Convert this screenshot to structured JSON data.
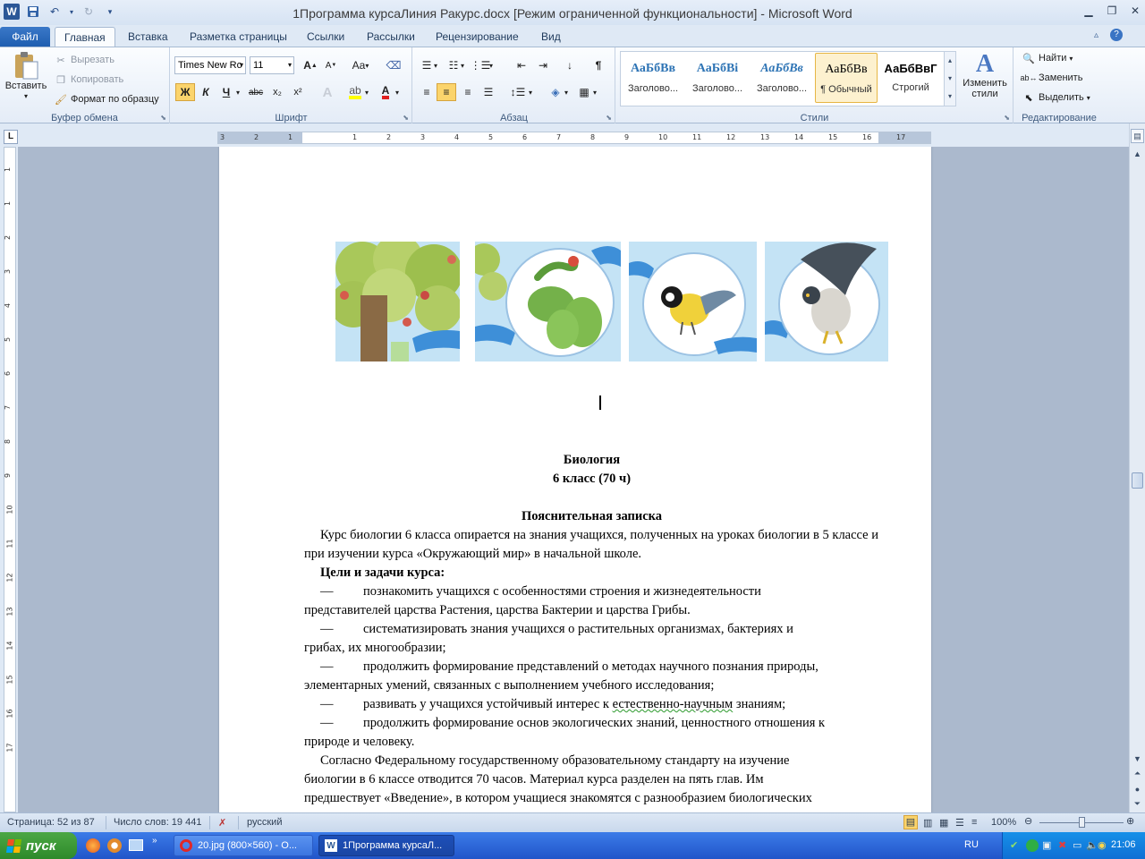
{
  "window": {
    "title": "1Программа курсаЛиния Ракурс.docx [Режим ограниченной функциональности]  -  Microsoft Word"
  },
  "tabs": [
    "Файл",
    "Главная",
    "Вставка",
    "Разметка страницы",
    "Ссылки",
    "Рассылки",
    "Рецензирование",
    "Вид"
  ],
  "clipboard": {
    "paste": "Вставить",
    "cut": "Вырезать",
    "copy": "Копировать",
    "format_painter": "Формат по образцу",
    "label": "Буфер обмена"
  },
  "font": {
    "name": "Times New Ro",
    "size": "11",
    "label": "Шрифт",
    "case": "Aa",
    "bold": "Ж",
    "italic": "К",
    "underline": "Ч",
    "strike": "abc",
    "sub": "x₂",
    "sup": "x²"
  },
  "paragraph": {
    "label": "Абзац",
    "pilcrow": "¶"
  },
  "styles": {
    "label": "Стили",
    "items": [
      {
        "sample": "АаБбВв",
        "name": "Заголово..."
      },
      {
        "sample": "АаБбВі",
        "name": "Заголово..."
      },
      {
        "sample": "АаБбВв",
        "name": "Заголово..."
      },
      {
        "sample": "АаБбВв",
        "name": "¶ Обычный"
      },
      {
        "sample": "АаБбВвГ",
        "name": "Строгий"
      }
    ],
    "change": "Изменить стили"
  },
  "editing": {
    "label": "Редактирование",
    "find": "Найти",
    "replace": "Заменить",
    "select": "Выделить"
  },
  "document": {
    "title1": "Биология",
    "title2": "6 класс (70 ч)",
    "heading": "Пояснительная записка",
    "p1": "Курс биологии 6 класса опирается на знания учащихся, полученных на уроках биологии в 5 классе и при изучении курса «Окружающий мир» в начальной школе.",
    "goals_title": "Цели и задачи курса:",
    "bullet_dash": "—",
    "b1a": "познакомить учащихся с особенностями строения и жизнедеятельности",
    "b1b": "представителей царства Растения, царства Бактерии и царства Грибы.",
    "b2a": "систематизировать знания учащихся о растительных организмах, бактериях и",
    "b2b": "грибах, их многообразии;",
    "b3a": "продолжить формирование представлений о методах научного познания природы,",
    "b3b": "элементарных умений, связанных с выполнением учебного исследования;",
    "b4a": "развивать у учащихся устойчивый интерес к ",
    "b4w": "естественно-научным",
    "b4b": " знаниям;",
    "b5a": "продолжить формирование основ экологических знаний, ценностного отношения к",
    "b5b": "природе и человеку.",
    "p2a": "Согласно Федеральному государственному образовательному стандарту на изучение",
    "p2b": "биологии в 6 классе отводится 70 часов. Материал курса разделен на пять глав. Им",
    "p2c": "предшествует «Введение», в котором учащиеся знакомятся с разнообразием биологических"
  },
  "statusbar": {
    "page": "Страница: 52 из 87",
    "words": "Число слов: 19 441",
    "lang": "русский",
    "zoom": "100%"
  },
  "taskbar": {
    "start": "пуск",
    "task1": "20.jpg (800×560) - O...",
    "task2": "1Программа курсаЛ...",
    "lang": "RU",
    "time": "21:06"
  },
  "ruler": {
    "h": [
      "3",
      "2",
      "1",
      "1",
      "2",
      "3",
      "4",
      "5",
      "6",
      "7",
      "8",
      "9",
      "10",
      "11",
      "12",
      "13",
      "14",
      "15",
      "16",
      "17"
    ],
    "v": [
      "1",
      "1",
      "2",
      "3",
      "4",
      "5",
      "6",
      "7",
      "8",
      "9",
      "10",
      "11",
      "12",
      "13",
      "14",
      "15",
      "16",
      "17"
    ]
  }
}
